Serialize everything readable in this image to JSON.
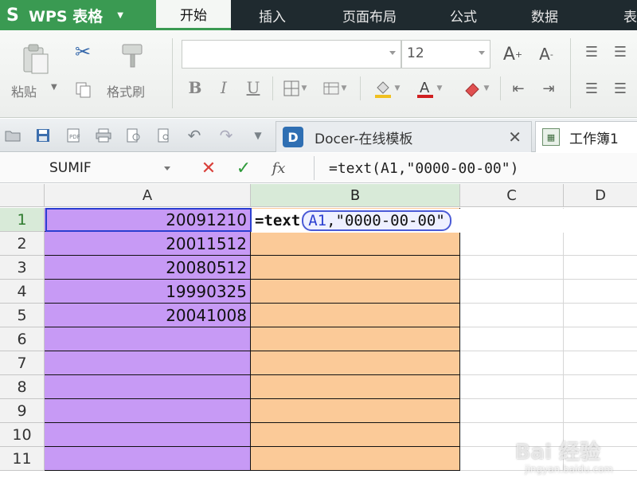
{
  "app": {
    "logo_mark": "S",
    "name": "WPS 表格",
    "logo_menu_arrow": "▼"
  },
  "menu": {
    "tabs": [
      "开始",
      "插入",
      "页面布局",
      "公式",
      "数据",
      "表"
    ]
  },
  "ribbon": {
    "paste_label": "粘贴",
    "format_painter_label": "格式刷",
    "font_name": "",
    "font_size": "12",
    "bold": "B",
    "italic": "I",
    "underline": "U"
  },
  "document_tabs": {
    "docer_label": "Docer-在线模板",
    "docer_icon": "D",
    "close_glyph": "✕",
    "workbook_label": "工作簿1"
  },
  "formula_bar": {
    "name_box": "SUMIF",
    "cancel_glyph": "✕",
    "confirm_glyph": "✓",
    "fx_label": "fx",
    "formula": "=text(A1,\"0000-00-00\")"
  },
  "sheet": {
    "columns": [
      "A",
      "B",
      "C",
      "D"
    ],
    "rows": [
      "1",
      "2",
      "3",
      "4",
      "5",
      "6",
      "7",
      "8",
      "9",
      "10",
      "11"
    ],
    "column_a_values": [
      "20091210",
      "20011512",
      "20080512",
      "19990325",
      "20041008",
      "",
      "",
      "",
      "",
      "",
      ""
    ],
    "editing_cell": {
      "function": "=text",
      "ref": "A1",
      "rest": ",\"0000-00-00\""
    },
    "colors": {
      "column_a_fill": "#c79af5",
      "column_b_fill": "#fbca98",
      "active_border": "#2b3fd0"
    }
  },
  "watermark": {
    "brand": "Bai 经验",
    "url": "jingyan.baidu.com"
  }
}
